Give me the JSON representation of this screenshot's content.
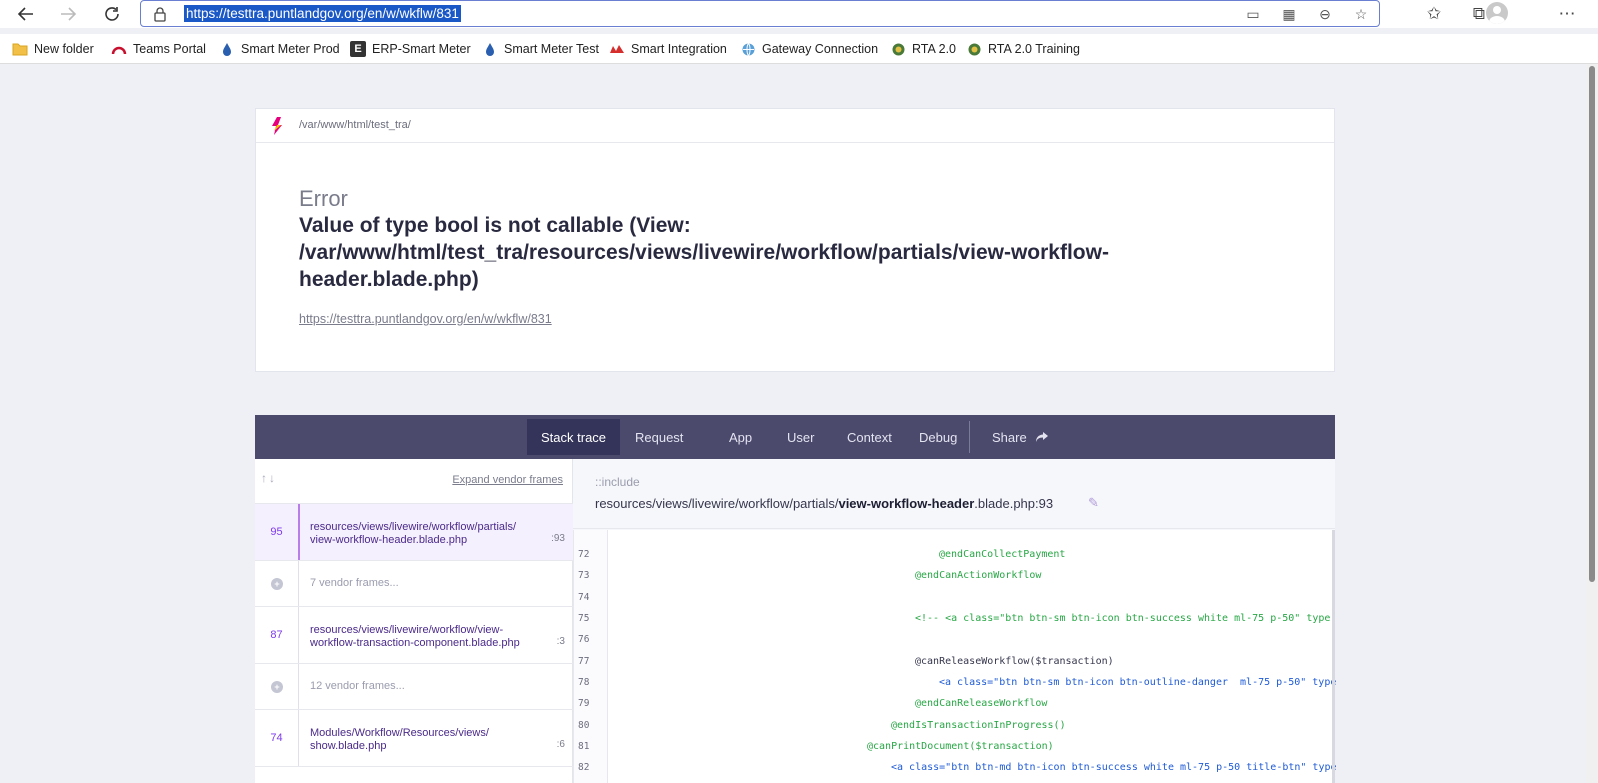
{
  "browser": {
    "url": "https://testtra.puntlandgov.org/en/w/wkflw/831",
    "bookmarks": [
      {
        "label": "New folder",
        "icon": "folder-icon"
      },
      {
        "label": "Teams Portal",
        "icon": "teams-portal-icon"
      },
      {
        "label": "Smart Meter Prod",
        "icon": "droplet-icon"
      },
      {
        "label": "ERP-Smart Meter",
        "icon": "erp-icon"
      },
      {
        "label": "Smart Meter Test",
        "icon": "droplet-icon"
      },
      {
        "label": "Smart Integration",
        "icon": "smart-integration-icon"
      },
      {
        "label": "Gateway Connection",
        "icon": "globe-icon"
      },
      {
        "label": "RTA 2.0",
        "icon": "emblem-icon"
      },
      {
        "label": "RTA 2.0 Training",
        "icon": "emblem-icon"
      }
    ]
  },
  "error": {
    "app_path": "/var/www/html/test_tra/",
    "kind": "Error",
    "message": "Value of type bool is not callable (View: /var/www/html/test_tra/resources/views/livewire/workflow/partials/view-workflow-header.blade.php)",
    "url": "https://testtra.puntlandgov.org/en/w/wkflw/831"
  },
  "tabs": {
    "stack_trace": "Stack trace",
    "request": "Request",
    "app": "App",
    "user": "User",
    "context": "Context",
    "debug": "Debug",
    "share": "Share"
  },
  "stack": {
    "expand_label": "Expand vendor frames",
    "frames": [
      {
        "number": "95",
        "file": "resources/views/livewire/workflow/partials/ view-workflow-header.blade.php",
        "line": ":93"
      },
      {
        "vendor": "7 vendor frames..."
      },
      {
        "number": "87",
        "file": "resources/views/livewire/workflow/view- workflow-transaction-component.blade.php",
        "line": ":3"
      },
      {
        "vendor": "12 vendor frames..."
      },
      {
        "number": "74",
        "file": "Modules/Workflow/Resources/views/ show.blade.php",
        "line": ":6"
      }
    ]
  },
  "code": {
    "include": "::include",
    "path_prefix": "resources/views/livewire/workflow/partials/",
    "path_bold": "view-workflow-header",
    "path_suffix": ".blade.php:93",
    "lines": [
      {
        "n": "72",
        "text": "@endCanCollectPayment"
      },
      {
        "n": "73",
        "text": "@endCanActionWorkflow"
      },
      {
        "n": "74",
        "text": ""
      },
      {
        "n": "75",
        "text": "<!-- <a class=\"btn btn-sm btn-icon btn-success white ml-75 p-50\" type"
      },
      {
        "n": "76",
        "text": ""
      },
      {
        "n": "77",
        "text": "@canReleaseWorkflow($transaction)"
      },
      {
        "n": "78",
        "text": "<a class=\"btn btn-sm btn-icon btn-outline-danger  ml-75 p-50\" type"
      },
      {
        "n": "79",
        "text": "@endCanReleaseWorkflow"
      },
      {
        "n": "80",
        "text": "@endIsTransactionInProgress()"
      },
      {
        "n": "81",
        "text": "@canPrintDocument($transaction)"
      },
      {
        "n": "82",
        "text": "<a class=\"btn btn-md btn-icon btn-success white ml-75 p-50 title-btn\" type"
      }
    ]
  }
}
